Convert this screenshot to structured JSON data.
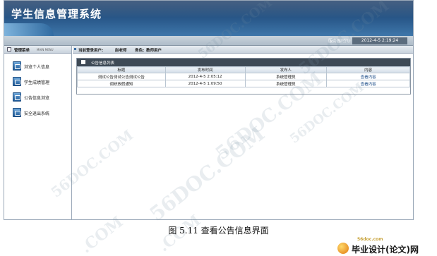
{
  "header": {
    "app_title": "学生信息管理系统",
    "server_time_label": "服务器时间:",
    "server_time_value": "2012-4-5 2:19:24"
  },
  "sidebar": {
    "title": "管理菜单",
    "subtitle": "MAIN MENU",
    "items": [
      {
        "label": "浏览个人信息",
        "icon": "person-info-icon"
      },
      {
        "label": "学生成绩管理",
        "icon": "grades-icon"
      },
      {
        "label": "公告信息浏览",
        "icon": "notice-icon"
      },
      {
        "label": "安全退出系统",
        "icon": "exit-icon"
      }
    ]
  },
  "userbar": {
    "user_label": "当前登录用户:",
    "user_name": "赵老师",
    "role_label": "角色:",
    "role_name": "教师用户"
  },
  "notice_panel": {
    "title": "公告信息列表",
    "columns": [
      "标题",
      "发布时间",
      "发布人",
      "内容"
    ],
    "rows": [
      {
        "title": "测试公告测试公告测试公告",
        "time": "2012-4-5 2:05:12",
        "publisher": "系统管理员",
        "action": "查看内容"
      },
      {
        "title": "调研放假通知",
        "time": "2012-4-5 1:09:50",
        "publisher": "系统管理员",
        "action": "查看内容"
      }
    ]
  },
  "caption": "图 5.11 查看公告信息界面",
  "watermarks": {
    "text": "56DOC.COM",
    "short": ".COM"
  },
  "footer_logo": {
    "url": "56doc.com",
    "text": "毕业设计(论文)网"
  }
}
